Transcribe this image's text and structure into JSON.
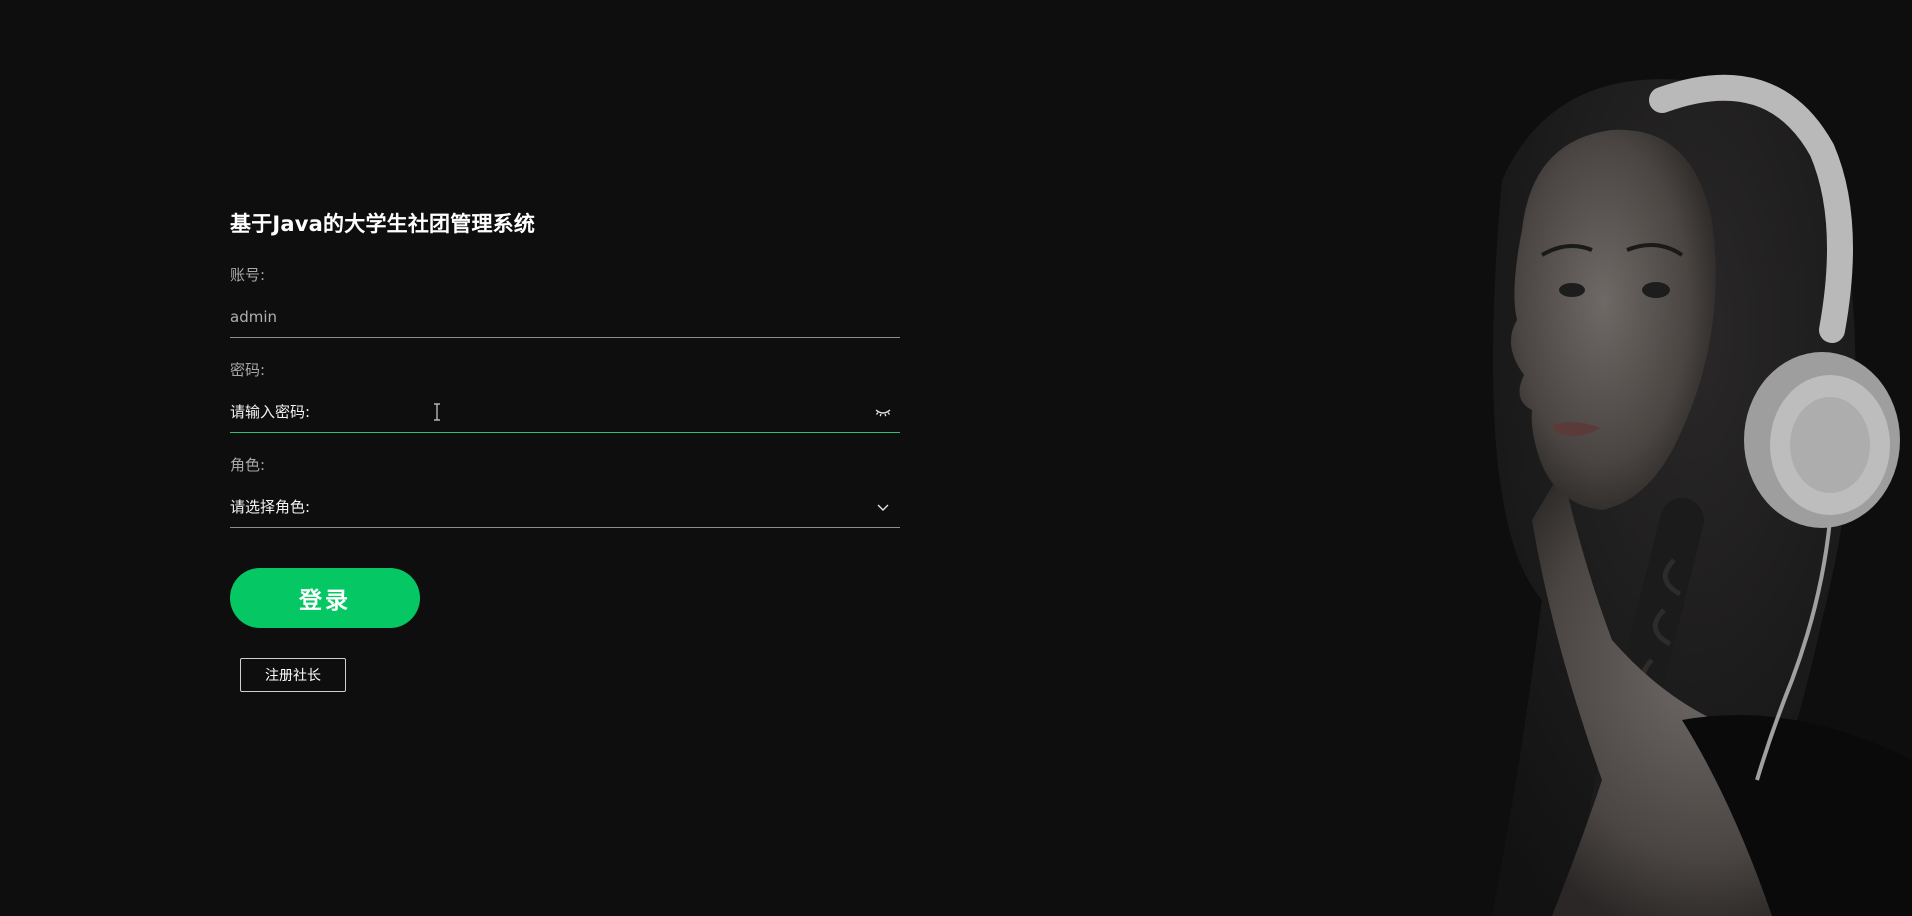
{
  "login": {
    "title": "基于Java的大学生社团管理系统",
    "account": {
      "label": "账号:",
      "value": "admin"
    },
    "password": {
      "label": "密码:",
      "placeholder": "请输入密码:"
    },
    "role": {
      "label": "角色:",
      "placeholder": "请选择角色:"
    },
    "login_button": "登录",
    "register_button": "注册社长"
  },
  "icons": {
    "password_toggle": "eye-closed-icon",
    "role_dropdown": "chevron-down-icon",
    "cursor": "text-cursor-icon"
  },
  "colors": {
    "background": "#0e0e0f",
    "accent": "#05c865",
    "focus_underline": "#2fbe72"
  }
}
